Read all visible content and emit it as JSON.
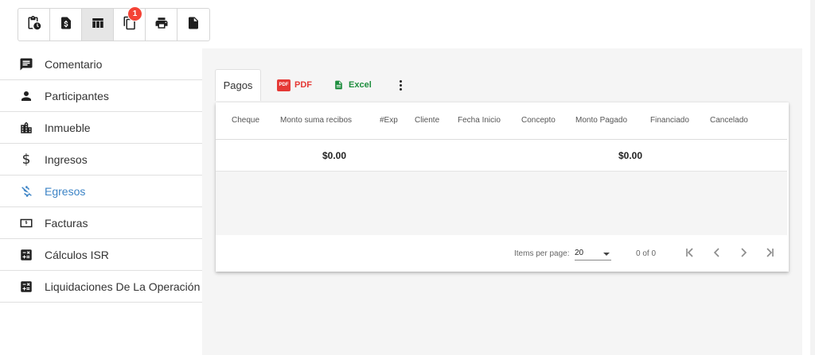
{
  "toolbar": {
    "buttons": [
      {
        "name": "clipboard-clock-icon",
        "active": false
      },
      {
        "name": "invoice-dollar-icon",
        "active": false
      },
      {
        "name": "table-columns-icon",
        "active": true
      },
      {
        "name": "copy-icon",
        "active": false,
        "badge": "1"
      },
      {
        "name": "printer-icon",
        "active": false
      },
      {
        "name": "document-icon",
        "active": false
      }
    ]
  },
  "sidebar": {
    "items": [
      {
        "label": "Comentario",
        "icon": "comment-icon",
        "active": false
      },
      {
        "label": "Participantes",
        "icon": "person-icon",
        "active": false
      },
      {
        "label": "Inmueble",
        "icon": "building-icon",
        "active": false
      },
      {
        "label": "Ingresos",
        "icon": "dollar-icon",
        "active": false
      },
      {
        "label": "Egresos",
        "icon": "money-off-icon",
        "active": true
      },
      {
        "label": "Facturas",
        "icon": "money-bill-icon",
        "active": false
      },
      {
        "label": "Cálculos ISR",
        "icon": "calculator-icon",
        "active": false
      },
      {
        "label": "Liquidaciones De La Operación",
        "icon": "calculator-icon",
        "active": false
      }
    ]
  },
  "tabs": {
    "active_tab": "Pagos",
    "pdf_label": "PDF",
    "excel_label": "Excel"
  },
  "table": {
    "columns": [
      "Cheque",
      "Monto suma recibos",
      "#Exp",
      "Cliente",
      "Fecha Inicio",
      "Concepto",
      "Monto Pagado",
      "Financiado",
      "Cancelado"
    ],
    "footer": {
      "monto_suma_recibos": "$0.00",
      "monto_pagado": "$0.00"
    }
  },
  "paginator": {
    "items_per_page_label": "Items per page:",
    "items_per_page_value": "20",
    "range_label": "0 of 0"
  },
  "colors": {
    "accent_blue": "#3d84c6",
    "pdf_red": "#e53935",
    "excel_green": "#1e8e3e",
    "badge_red": "#f44336"
  }
}
